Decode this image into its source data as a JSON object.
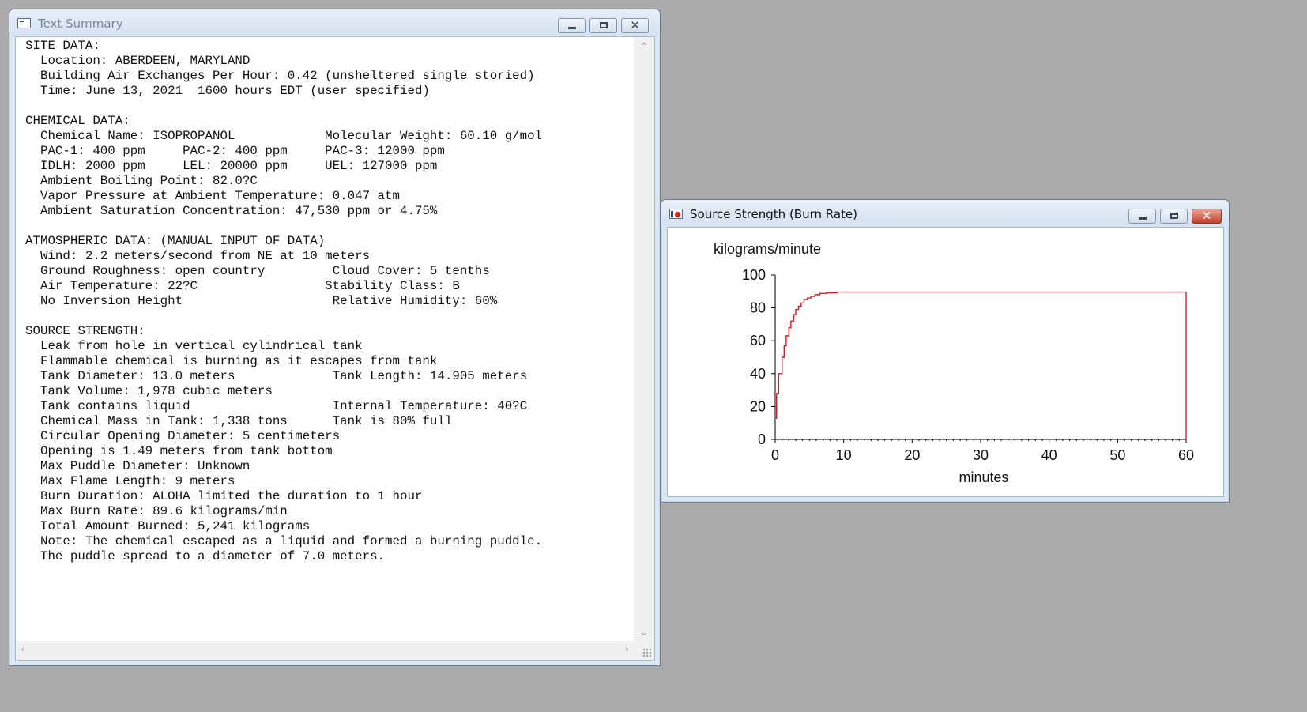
{
  "text_window": {
    "title": "Text Summary",
    "lines": [
      "SITE DATA:",
      "  Location: ABERDEEN, MARYLAND",
      "  Building Air Exchanges Per Hour: 0.42 (unsheltered single storied)",
      "  Time: June 13, 2021  1600 hours EDT (user specified)",
      "",
      "CHEMICAL DATA:",
      "  Chemical Name: ISOPROPANOL            Molecular Weight: 60.10 g/mol",
      "  PAC-1: 400 ppm     PAC-2: 400 ppm     PAC-3: 12000 ppm",
      "  IDLH: 2000 ppm     LEL: 20000 ppm     UEL: 127000 ppm",
      "  Ambient Boiling Point: 82.0?C",
      "  Vapor Pressure at Ambient Temperature: 0.047 atm",
      "  Ambient Saturation Concentration: 47,530 ppm or 4.75%",
      "",
      "ATMOSPHERIC DATA: (MANUAL INPUT OF DATA)",
      "  Wind: 2.2 meters/second from NE at 10 meters",
      "  Ground Roughness: open country         Cloud Cover: 5 tenths",
      "  Air Temperature: 22?C                 Stability Class: B",
      "  No Inversion Height                    Relative Humidity: 60%",
      "",
      "SOURCE STRENGTH:",
      "  Leak from hole in vertical cylindrical tank",
      "  Flammable chemical is burning as it escapes from tank",
      "  Tank Diameter: 13.0 meters             Tank Length: 14.905 meters",
      "  Tank Volume: 1,978 cubic meters",
      "  Tank contains liquid                   Internal Temperature: 40?C",
      "  Chemical Mass in Tank: 1,338 tons      Tank is 80% full",
      "  Circular Opening Diameter: 5 centimeters",
      "  Opening is 1.49 meters from tank bottom",
      "  Max Puddle Diameter: Unknown",
      "  Max Flame Length: 9 meters",
      "  Burn Duration: ALOHA limited the duration to 1 hour",
      "  Max Burn Rate: 89.6 kilograms/min",
      "  Total Amount Burned: 5,241 kilograms",
      "  Note: The chemical escaped as a liquid and formed a burning puddle.",
      "  The puddle spread to a diameter of 7.0 meters."
    ]
  },
  "chart_window": {
    "title": "Source Strength (Burn Rate)"
  },
  "chart_data": {
    "type": "line",
    "step": true,
    "ylabel": "kilograms/minute",
    "xlabel": "minutes",
    "xlim": [
      0,
      60
    ],
    "ylim": [
      0,
      100
    ],
    "xticks": [
      0,
      10,
      20,
      30,
      40,
      50,
      60
    ],
    "yticks": [
      0,
      20,
      40,
      60,
      80,
      100
    ],
    "line_color": "#e8141c",
    "grid": false,
    "series": [
      {
        "x": [
          0,
          0.2,
          0.2,
          0.5,
          0.5,
          1.0,
          1.0,
          1.3,
          1.3,
          1.6,
          1.6,
          2.0,
          2.0,
          2.3,
          2.3,
          2.7,
          2.7,
          3.0,
          3.0,
          3.4,
          3.4,
          3.8,
          3.8,
          4.2,
          4.2,
          4.7,
          4.7,
          5.2,
          5.2,
          5.8,
          5.8,
          6.5,
          6.5,
          7.5,
          7.5,
          9.0,
          9.0,
          60,
          60
        ],
        "y": [
          13,
          13,
          28,
          28,
          40,
          40,
          50,
          50,
          57,
          57,
          63,
          63,
          68,
          68,
          72,
          72,
          76,
          76,
          79,
          79,
          81,
          81,
          83,
          83,
          85,
          85,
          86,
          86,
          87,
          87,
          88,
          88,
          88.8,
          88.8,
          89.2,
          89.2,
          89.6,
          89.6,
          0
        ]
      }
    ]
  }
}
